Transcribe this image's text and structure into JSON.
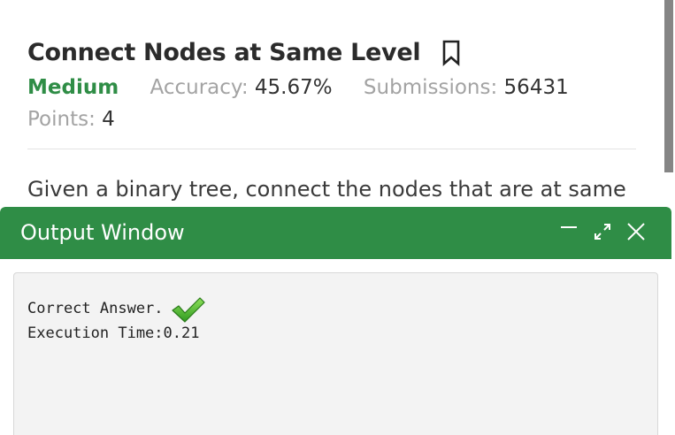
{
  "problem": {
    "title": "Connect Nodes at Same Level",
    "bookmark_icon": "bookmark-icon",
    "difficulty": "Medium",
    "accuracy_label": "Accuracy: ",
    "accuracy_value": "45.67%",
    "submissions_label": "Submissions: ",
    "submissions_value": "56431",
    "points_label": "Points: ",
    "points_value": "4",
    "description": "Given a binary tree, connect the nodes that are at same"
  },
  "output_window": {
    "title": "Output Window",
    "controls": {
      "minimize_icon": "minimize-icon",
      "expand_icon": "expand-icon",
      "close_icon": "close-icon"
    },
    "result": "Correct Answer.",
    "result_icon": "checkmark-icon",
    "execution_time": "Execution Time:0.21"
  },
  "colors": {
    "accent_green": "#2f8d46",
    "title_text": "#2b2b2b",
    "muted_text": "#a3a3a3"
  }
}
